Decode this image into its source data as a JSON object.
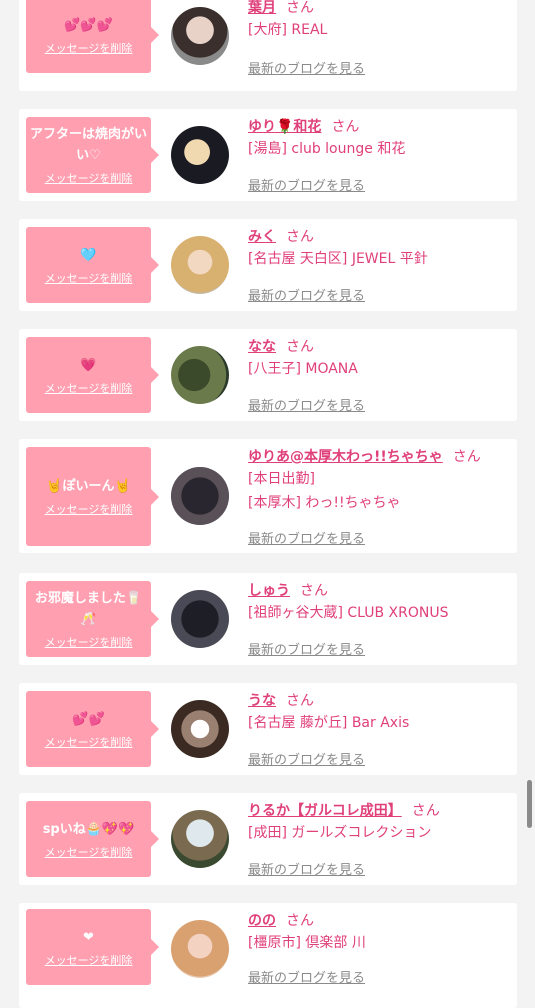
{
  "ui": {
    "delete_label": "メッセージを削除",
    "blog_label": "最新のブログを見る",
    "honorific": "さん",
    "colors": {
      "bubble": "#ff9fb0",
      "accent": "#e0407a",
      "link_gray": "#8a8a8a"
    }
  },
  "entries": [
    {
      "name": "葉月",
      "shops": [
        "[大府] REAL"
      ],
      "message": "💕💕💕"
    },
    {
      "name": "ゆり🌹和花",
      "shops": [
        "[湯島] club lounge 和花"
      ],
      "message": "アフターは焼肉がいい♡"
    },
    {
      "name": "みく",
      "shops": [
        "[名古屋 天白区] JEWEL 平針"
      ],
      "message": "🩵"
    },
    {
      "name": "なな",
      "shops": [
        "[八王子] MOANA"
      ],
      "message": "💗"
    },
    {
      "name": "ゆりあ@本厚木わっ!!ちゃちゃ",
      "shops": [
        "[本日出勤]",
        "[本厚木] わっ!!ちゃちゃ"
      ],
      "message": "🤘ぽいーん🤘"
    },
    {
      "name": "しゅう",
      "shops": [
        "[祖師ヶ谷大蔵] CLUB XRONUS"
      ],
      "message": "お邪魔しました🥛🥂"
    },
    {
      "name": "うな",
      "shops": [
        "[名古屋 藤が丘] Bar Axis"
      ],
      "message": "💕💕"
    },
    {
      "name": "りるか【ガルコレ成田】",
      "shops": [
        "[成田] ガールズコレクション"
      ],
      "message": "spいね🧁💖💖"
    },
    {
      "name": "のの",
      "shops": [
        "[橿原市] 倶楽部 川"
      ],
      "message": "❤"
    }
  ]
}
